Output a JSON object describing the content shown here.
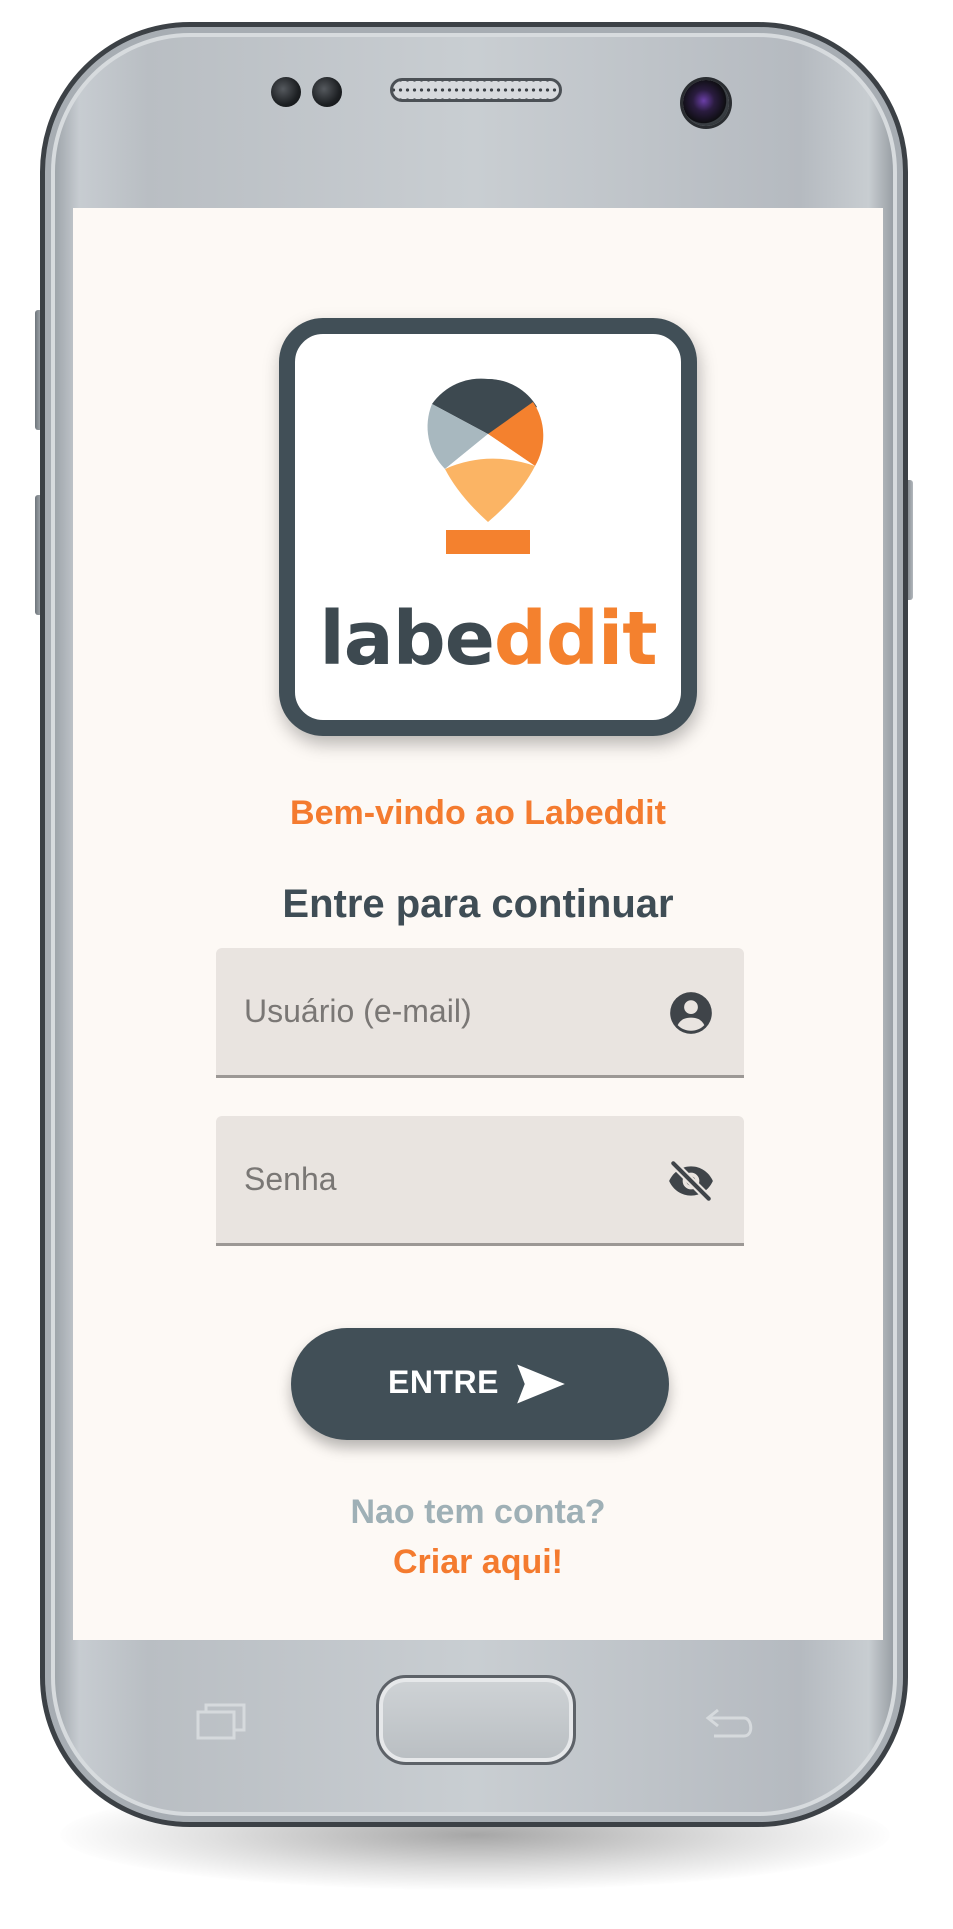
{
  "device": {
    "hardware_icons": [
      "recent-apps-icon",
      "home-button",
      "back-icon"
    ]
  },
  "logo": {
    "text_dark": "labe",
    "text_orange": "ddit",
    "colors": {
      "frame": "#414f57",
      "dark_slice": "#3d4950",
      "orange_slice": "#f4812e",
      "blue_slice": "#a8b8bf",
      "light_orange_slice": "#fbb464"
    }
  },
  "login": {
    "welcome": "Bem-vindo ao Labeddit",
    "subtitle": "Entre para continuar",
    "user_field": {
      "placeholder": "Usuário (e-mail)",
      "value": "",
      "icon": "account-circle-icon"
    },
    "password_field": {
      "placeholder": "Senha",
      "value": "",
      "icon": "eye-off-icon"
    },
    "submit": {
      "label": "ENTRE",
      "icon": "send-icon"
    },
    "no_account": "Nao tem conta?",
    "create_account": "Criar aqui!"
  },
  "theme": {
    "accent": "#f47b2f",
    "primary": "#414f57",
    "background": "#fdf9f5",
    "muted": "#9fb0b6"
  }
}
